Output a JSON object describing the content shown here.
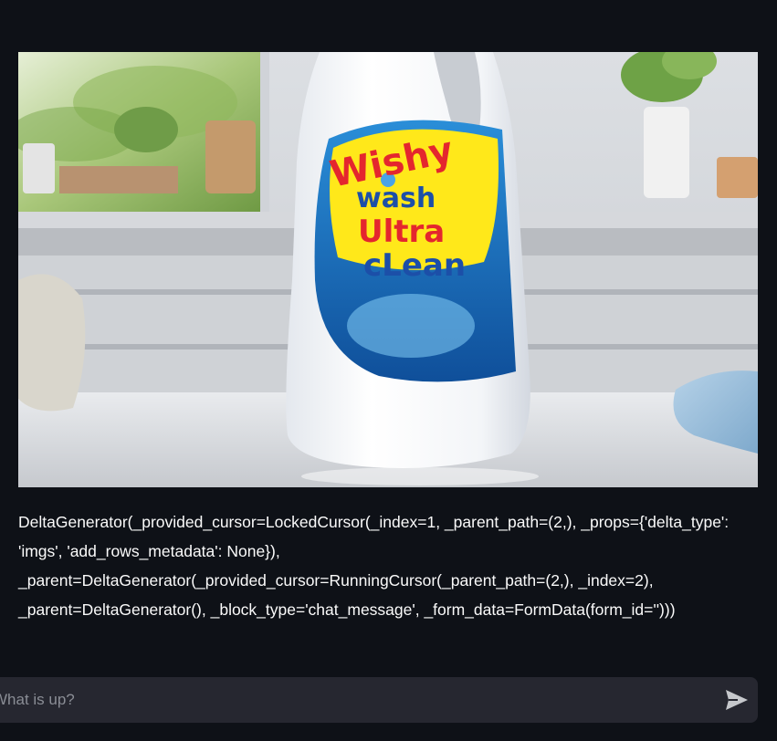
{
  "chat": {
    "message": {
      "image_label_text": {
        "line1": "Wishy",
        "line2": "wash",
        "line3": "Ultra",
        "line4": "cLean"
      },
      "text": "DeltaGenerator(_provided_cursor=LockedCursor(_index=1, _parent_path=(2,), _props={'delta_type': 'imgs', 'add_rows_metadata': None}), _parent=DeltaGenerator(_provided_cursor=RunningCursor(_parent_path=(2,), _index=2), _parent=DeltaGenerator(), _block_type='chat_message', _form_data=FormData(form_id='')))"
    },
    "input": {
      "placeholder": "What is up?",
      "value": ""
    },
    "send_icon": "send-icon"
  },
  "colors": {
    "background": "#0e1117",
    "input_background": "#262730",
    "text": "#fafafa",
    "placeholder": "#8a8d95"
  }
}
